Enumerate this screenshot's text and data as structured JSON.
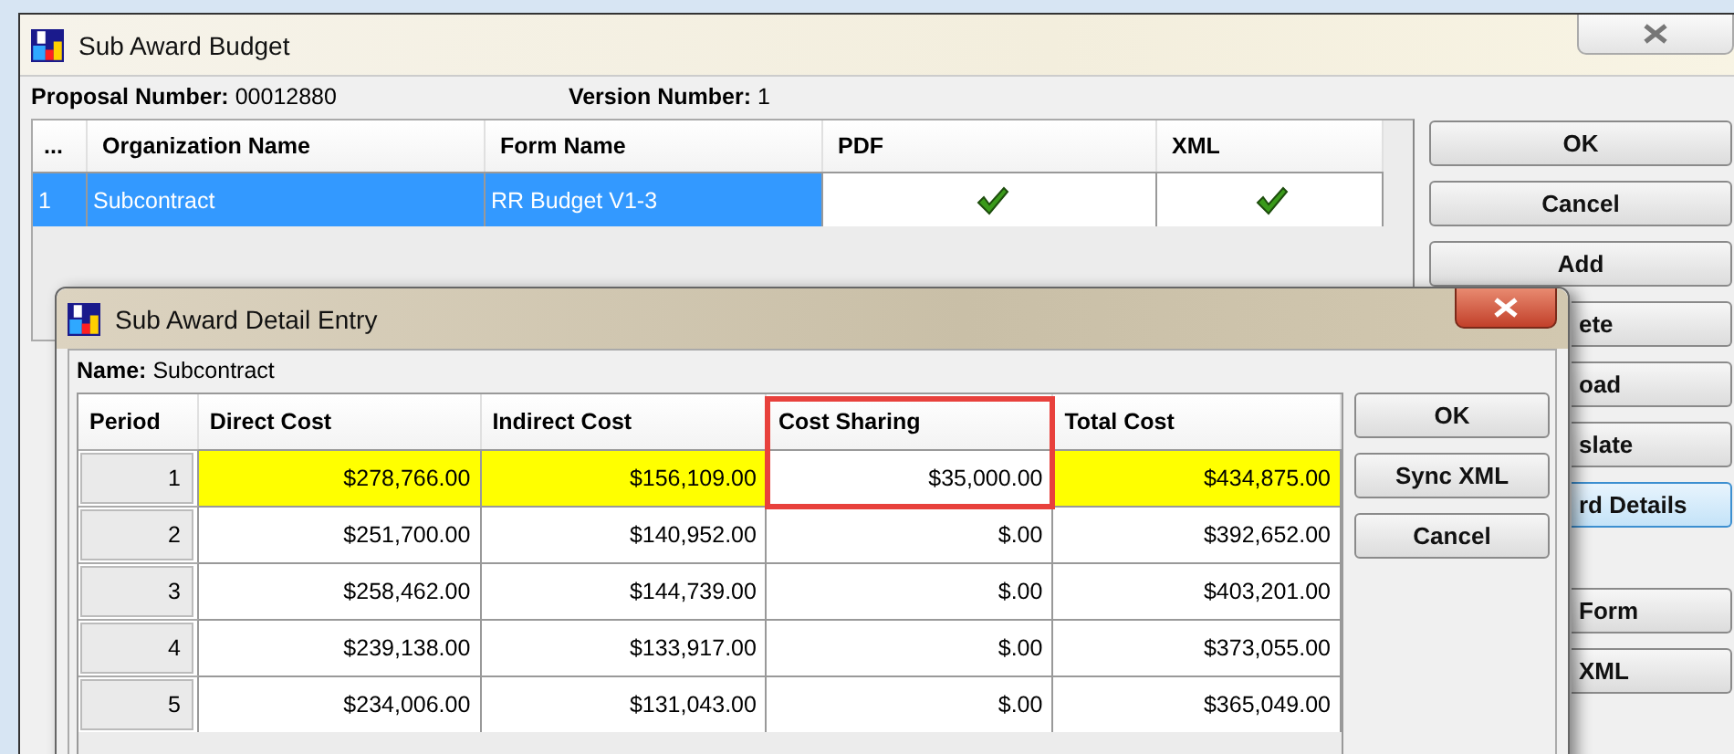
{
  "window": {
    "title": "Sub Award Budget"
  },
  "proposal": {
    "label": "Proposal Number:",
    "value": "00012880"
  },
  "version": {
    "label": "Version Number:",
    "value": "1"
  },
  "table": {
    "columns": [
      "...",
      "Organization Name",
      "Form Name",
      "PDF",
      "XML"
    ],
    "rows": [
      {
        "index": "1",
        "organization": "Subcontract",
        "form": "RR Budget V1-3",
        "pdf": true,
        "xml": true,
        "selected": true
      }
    ]
  },
  "buttons": [
    {
      "label": "OK"
    },
    {
      "label": "Cancel"
    },
    {
      "label": "Add"
    }
  ],
  "partly_hidden_buttons": [
    {
      "label": "ete",
      "focused": false
    },
    {
      "label": "oad",
      "focused": false
    },
    {
      "label": "slate",
      "focused": false
    },
    {
      "label": "rd Details",
      "focused": true
    },
    {
      "label": "Form",
      "focused": false
    },
    {
      "label": "XML",
      "focused": false
    }
  ],
  "dialog": {
    "title": "Sub Award Detail Entry",
    "name": {
      "label": "Name:",
      "value": "Subcontract"
    },
    "columns": [
      {
        "label": "Period",
        "outlined": false
      },
      {
        "label": "Direct Cost",
        "outlined": false
      },
      {
        "label": "Indirect Cost",
        "outlined": false
      },
      {
        "label": "Cost Sharing",
        "outlined": true
      },
      {
        "label": "Total Cost",
        "outlined": false
      }
    ],
    "rows": [
      {
        "period": "1",
        "cells": [
          {
            "value": "$278,766.00",
            "highlighted": true
          },
          {
            "value": "$156,109.00",
            "highlighted": true
          },
          {
            "value": "$35,000.00",
            "highlighted": false
          },
          {
            "value": "$434,875.00",
            "highlighted": true
          }
        ]
      },
      {
        "period": "2",
        "cells": [
          {
            "value": "$251,700.00",
            "highlighted": false
          },
          {
            "value": "$140,952.00",
            "highlighted": false
          },
          {
            "value": "$.00",
            "highlighted": false
          },
          {
            "value": "$392,652.00",
            "highlighted": false
          }
        ]
      },
      {
        "period": "3",
        "cells": [
          {
            "value": "$258,462.00",
            "highlighted": false
          },
          {
            "value": "$144,739.00",
            "highlighted": false
          },
          {
            "value": "$.00",
            "highlighted": false
          },
          {
            "value": "$403,201.00",
            "highlighted": false
          }
        ]
      },
      {
        "period": "4",
        "cells": [
          {
            "value": "$239,138.00",
            "highlighted": false
          },
          {
            "value": "$133,917.00",
            "highlighted": false
          },
          {
            "value": "$.00",
            "highlighted": false
          },
          {
            "value": "$373,055.00",
            "highlighted": false
          }
        ]
      },
      {
        "period": "5",
        "cells": [
          {
            "value": "$234,006.00",
            "highlighted": false
          },
          {
            "value": "$131,043.00",
            "highlighted": false
          },
          {
            "value": "$.00",
            "highlighted": false
          },
          {
            "value": "$365,049.00",
            "highlighted": false
          }
        ]
      }
    ],
    "buttons": [
      "OK",
      "Sync XML",
      "Cancel"
    ]
  }
}
